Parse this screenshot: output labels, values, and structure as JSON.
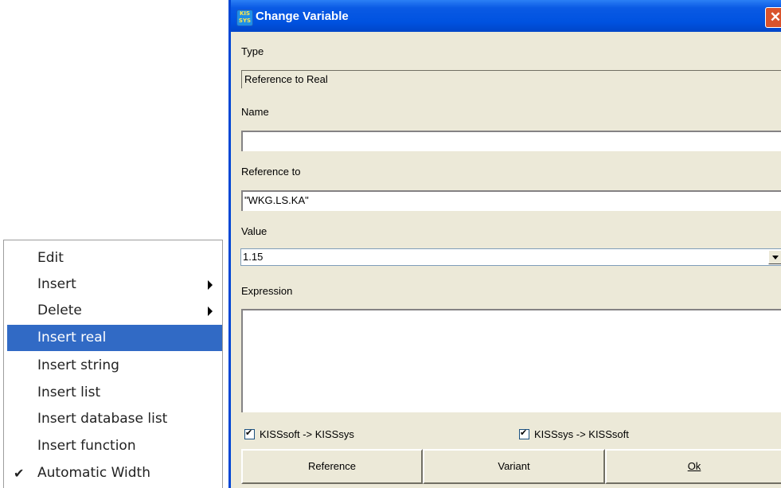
{
  "context_menu": {
    "items": [
      {
        "label": "Edit"
      },
      {
        "label": "Insert"
      },
      {
        "label": "Delete"
      },
      {
        "label": "Insert real"
      },
      {
        "label": "Insert string"
      },
      {
        "label": "Insert list"
      },
      {
        "label": "Insert database list"
      },
      {
        "label": "Insert function"
      },
      {
        "label": "Automatic Width"
      }
    ],
    "highlighted": "Insert real",
    "checked": "Automatic Width"
  },
  "dialog": {
    "title": "Change Variable",
    "icon_text": "KISS sys",
    "close_glyph": "✕",
    "type_label": "Type",
    "type_value": "Reference to Real",
    "name_label": "Name",
    "name_value": "",
    "reference_label": "Reference to",
    "reference_value": "\"WKG.LS.KA\"",
    "value_label": "Value",
    "value_value": "1.15",
    "expression_label": "Expression",
    "expression_value": "",
    "checkbox1_label": "KISSsoft -> KISSsys",
    "checkbox1_checked": true,
    "checkbox2_label": "KISSsys -> KISSsoft",
    "checkbox2_checked": true,
    "btn_reference": "Reference",
    "btn_variant": "Variant",
    "btn_ok": "Ok"
  },
  "colors": {
    "highlight": "#316ac5",
    "dialog_bg": "#ece9d8",
    "title_blue": "#0052e0",
    "close_red": "#d9532c"
  }
}
